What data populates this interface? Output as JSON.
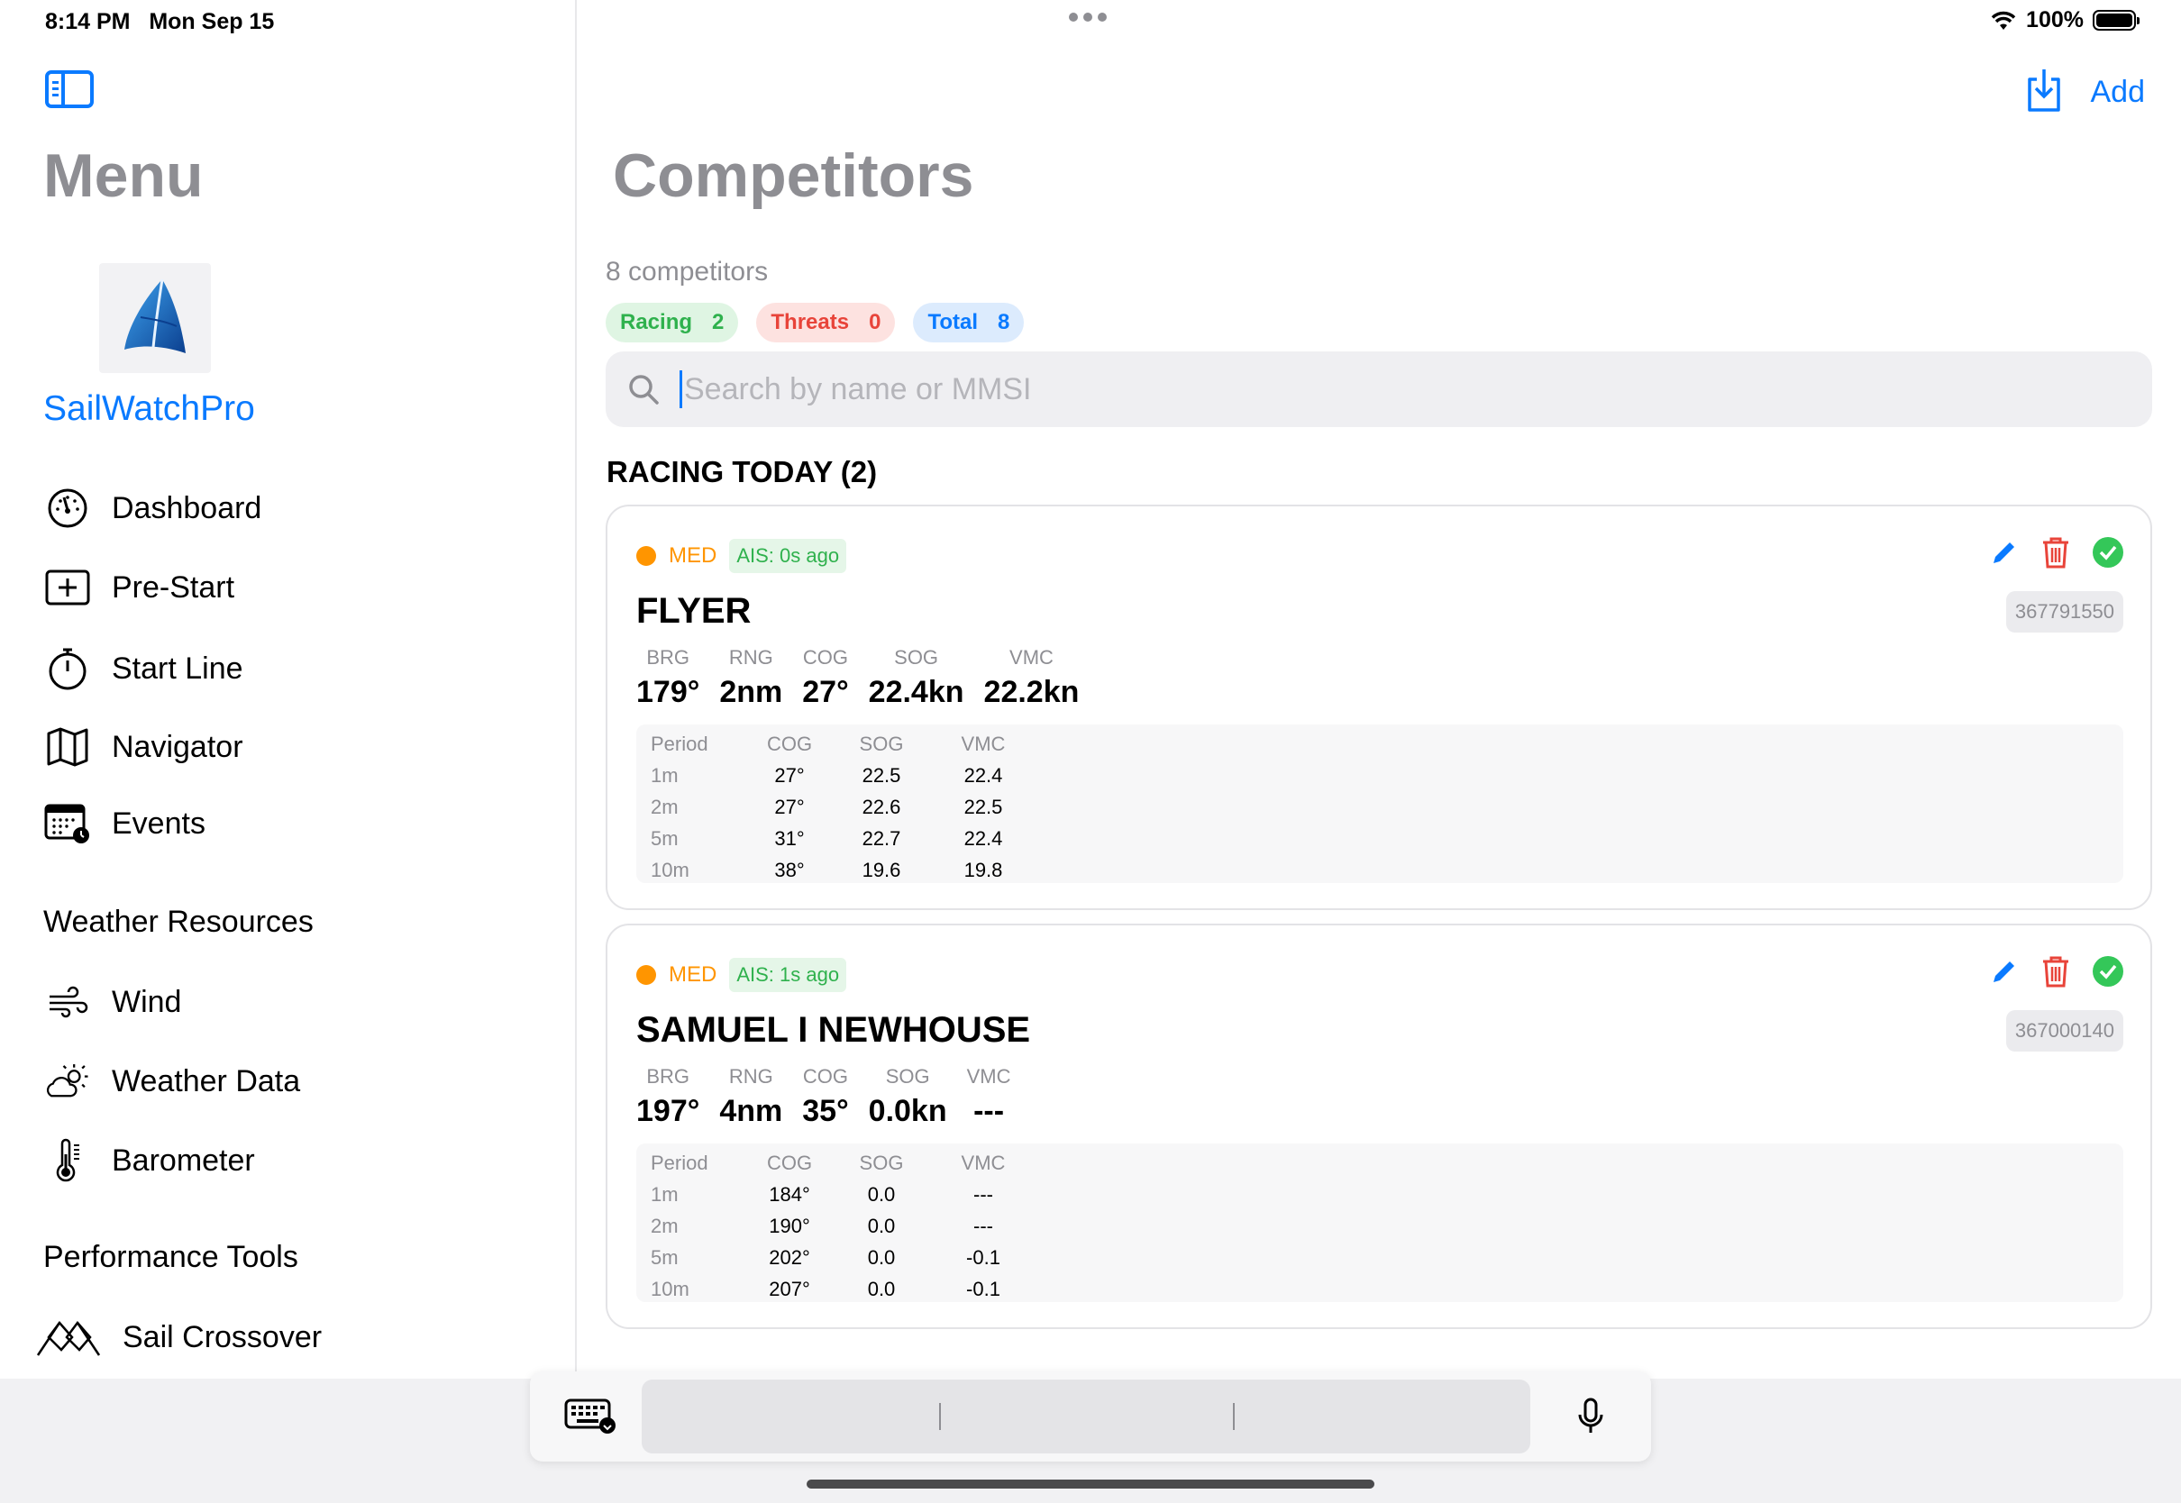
{
  "status_bar": {
    "time": "8:14 PM",
    "date": "Mon Sep 15",
    "battery": "100%"
  },
  "sidebar": {
    "title": "Menu",
    "app_name": "SailWatchPro",
    "items": [
      {
        "label": "Dashboard",
        "icon": "gauge-icon"
      },
      {
        "label": "Pre-Start",
        "icon": "plus-square-icon"
      },
      {
        "label": "Start Line",
        "icon": "stopwatch-icon"
      },
      {
        "label": "Navigator",
        "icon": "map-icon"
      },
      {
        "label": "Events",
        "icon": "calendar-clock-icon"
      }
    ],
    "weather_section": "Weather Resources",
    "weather_items": [
      {
        "label": "Wind",
        "icon": "wind-icon"
      },
      {
        "label": "Weather Data",
        "icon": "sun-cloud-icon"
      },
      {
        "label": "Barometer",
        "icon": "thermometer-icon"
      }
    ],
    "performance_section": "Performance Tools",
    "performance_items": [
      {
        "label": "Sail Crossover",
        "icon": "flags-icon"
      }
    ]
  },
  "toolbar": {
    "add_label": "Add"
  },
  "main": {
    "title": "Competitors",
    "count_text": "8 competitors",
    "chips": [
      {
        "label": "Racing",
        "count": "2"
      },
      {
        "label": "Threats",
        "count": "0"
      },
      {
        "label": "Total",
        "count": "8"
      }
    ],
    "search_placeholder": "Search by name or MMSI",
    "section_title": "RACING TODAY (2)"
  },
  "competitors": [
    {
      "level": "MED",
      "ais": "AIS: 0s ago",
      "name": "FLYER",
      "mmsi": "367791550",
      "stats": [
        {
          "label": "BRG",
          "value": "179°"
        },
        {
          "label": "RNG",
          "value": "2nm"
        },
        {
          "label": "COG",
          "value": "27°"
        },
        {
          "label": "SOG",
          "value": "22.4kn"
        },
        {
          "label": "VMC",
          "value": "22.2kn"
        }
      ],
      "table_head": [
        "Period",
        "COG",
        "SOG",
        "VMC"
      ],
      "rows": [
        [
          "1m",
          "27°",
          "22.5",
          "22.4"
        ],
        [
          "2m",
          "27°",
          "22.6",
          "22.5"
        ],
        [
          "5m",
          "31°",
          "22.7",
          "22.4"
        ],
        [
          "10m",
          "38°",
          "19.6",
          "19.8"
        ]
      ]
    },
    {
      "level": "MED",
      "ais": "AIS: 1s ago",
      "name": "SAMUEL I NEWHOUSE",
      "mmsi": "367000140",
      "stats": [
        {
          "label": "BRG",
          "value": "197°"
        },
        {
          "label": "RNG",
          "value": "4nm"
        },
        {
          "label": "COG",
          "value": "35°"
        },
        {
          "label": "SOG",
          "value": "0.0kn"
        },
        {
          "label": "VMC",
          "value": "---"
        }
      ],
      "table_head": [
        "Period",
        "COG",
        "SOG",
        "VMC"
      ],
      "rows": [
        [
          "1m",
          "184°",
          "0.0",
          "---"
        ],
        [
          "2m",
          "190°",
          "0.0",
          "---"
        ],
        [
          "5m",
          "202°",
          "0.0",
          "-0.1"
        ],
        [
          "10m",
          "207°",
          "0.0",
          "-0.1"
        ]
      ]
    }
  ],
  "colors": {
    "accent": "#0a7aff",
    "racing": "#2fb14d",
    "threat": "#e8443a",
    "medium": "#ff9500"
  }
}
